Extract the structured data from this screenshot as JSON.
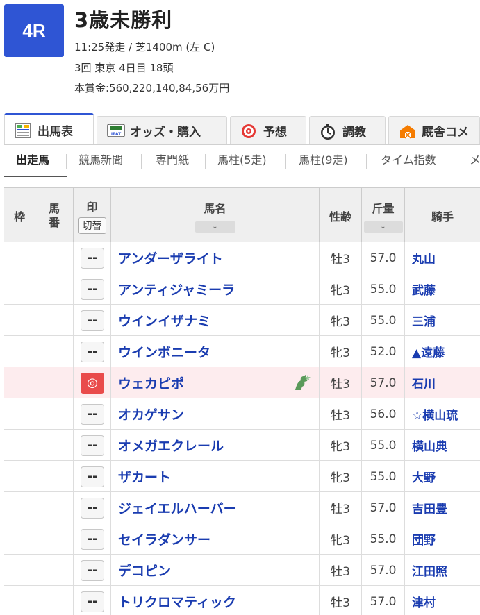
{
  "race": {
    "number": "4R",
    "title": "3歳未勝利",
    "start_info": "11:25発走 / 芝1400m (左 C)",
    "meeting": "3回 東京 4日目 18頭",
    "prize": "本賞金:560,220,140,84,56万円"
  },
  "main_tabs": [
    {
      "label": "出馬表",
      "icon": "table-icon",
      "active": true
    },
    {
      "label": "オッズ・購入",
      "icon": "ipat-icon",
      "active": false
    },
    {
      "label": "予想",
      "icon": "target-icon",
      "active": false
    },
    {
      "label": "調教",
      "icon": "stopwatch-icon",
      "active": false
    },
    {
      "label": "厩舎コメ",
      "icon": "stable-icon",
      "active": false
    }
  ],
  "sub_tabs": [
    {
      "label": "出走馬",
      "active": true
    },
    {
      "label": "競馬新聞",
      "active": false
    },
    {
      "label": "専門紙",
      "active": false
    },
    {
      "label": "馬柱(5走)",
      "active": false
    },
    {
      "label": "馬柱(9走)",
      "active": false
    },
    {
      "label": "タイム指数",
      "active": false
    },
    {
      "label": "メ",
      "active": false
    }
  ],
  "table": {
    "headers": {
      "waku": "枠",
      "umaban": "馬\n番",
      "mark": "印",
      "mark_switch": "切替",
      "name": "馬名",
      "sexage": "性齢",
      "weight": "斤量",
      "jockey": "騎手"
    },
    "rows": [
      {
        "mark": "--",
        "name": "アンダーザライト",
        "sexage": "牡3",
        "weight": "57.0",
        "jockey": "丸山"
      },
      {
        "mark": "--",
        "name": "アンティジャミーラ",
        "sexage": "牝3",
        "weight": "55.0",
        "jockey": "武藤"
      },
      {
        "mark": "--",
        "name": "ウインイザナミ",
        "sexage": "牝3",
        "weight": "55.0",
        "jockey": "三浦"
      },
      {
        "mark": "--",
        "name": "ウインボニータ",
        "sexage": "牝3",
        "weight": "52.0",
        "jockey": "▲遠藤"
      },
      {
        "mark": "◎",
        "name": "ウェカピポ",
        "sexage": "牡3",
        "weight": "57.0",
        "jockey": "石川",
        "highlight": true,
        "badge_icon": "horse-star-icon"
      },
      {
        "mark": "--",
        "name": "オカゲサン",
        "sexage": "牡3",
        "weight": "56.0",
        "jockey": "☆横山琉"
      },
      {
        "mark": "--",
        "name": "オメガエクレール",
        "sexage": "牝3",
        "weight": "55.0",
        "jockey": "横山典"
      },
      {
        "mark": "--",
        "name": "ザカート",
        "sexage": "牝3",
        "weight": "55.0",
        "jockey": "大野"
      },
      {
        "mark": "--",
        "name": "ジェイエルハーバー",
        "sexage": "牡3",
        "weight": "57.0",
        "jockey": "吉田豊"
      },
      {
        "mark": "--",
        "name": "セイラダンサー",
        "sexage": "牝3",
        "weight": "55.0",
        "jockey": "団野"
      },
      {
        "mark": "--",
        "name": "デコピン",
        "sexage": "牡3",
        "weight": "57.0",
        "jockey": "江田照"
      },
      {
        "mark": "--",
        "name": "トリクロマティック",
        "sexage": "牡3",
        "weight": "57.0",
        "jockey": "津村"
      }
    ]
  },
  "colors": {
    "accent": "#2f55d4",
    "link": "#1a3cb0",
    "highlight_row": "#fdecee",
    "mark_active": "#e94b4b"
  }
}
